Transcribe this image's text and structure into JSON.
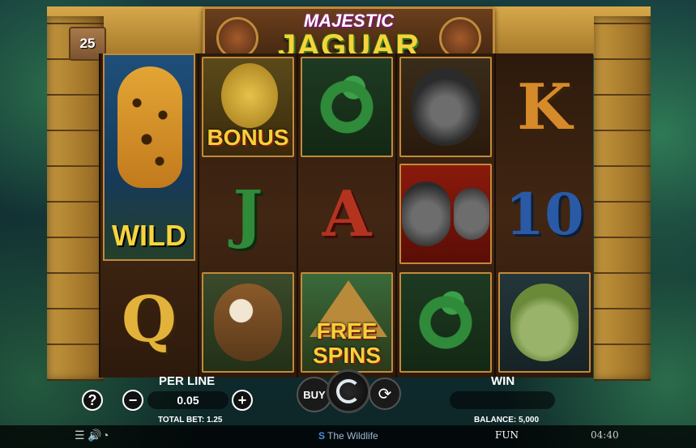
{
  "game": {
    "title_top": "MAJESTIC",
    "title_main": "JAGUAR",
    "lines_count": "25"
  },
  "reels": {
    "reel1": {
      "wild_label": "WILD",
      "bottom_letter": "Q"
    },
    "reel2": {
      "top_label": "BONUS",
      "mid_letter": "J",
      "bottom_symbol": "eagle"
    },
    "reel3": {
      "top_symbol": "snake",
      "mid_letter": "A",
      "bottom_label": "FREE SPINS"
    },
    "reel4": {
      "top_symbol": "gorilla",
      "mid_symbol": "two-gorillas",
      "bottom_symbol": "snake"
    },
    "reel5": {
      "top_letter": "K",
      "mid_letter": "10",
      "bottom_symbol": "frog"
    }
  },
  "controls": {
    "per_line_label": "PER LINE",
    "bet_value": "0.05",
    "win_label": "WIN",
    "buy_label": "BUY",
    "help_label": "?",
    "minus_label": "−",
    "plus_label": "+",
    "total_bet": "TOTAL BET: 1.25",
    "balance": "BALANCE: 5,000"
  },
  "statusbar": {
    "brand": "The Wildlife",
    "mode": "FUN",
    "time": "04:40"
  },
  "colors": {
    "title_gold": "#f7d23a",
    "reel_bg": "#3a2412",
    "frame_stone": "#b88a3f"
  }
}
